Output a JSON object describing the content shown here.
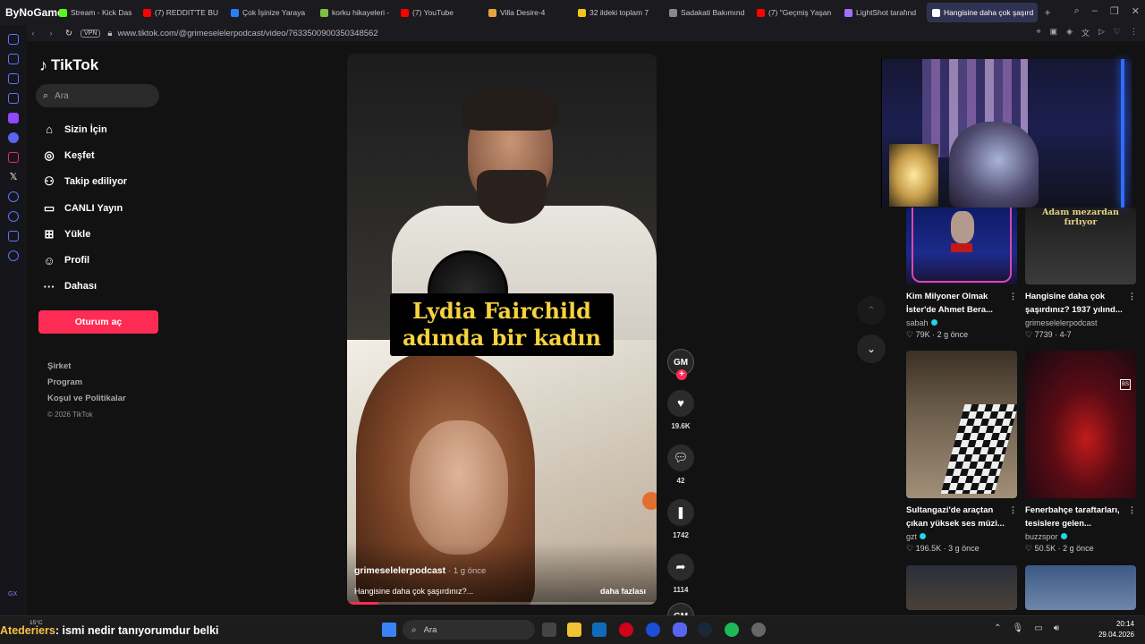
{
  "browser": {
    "brand": "ByNoGame",
    "tabs": [
      {
        "label": "Stream - Kick Das",
        "color": "#53fc18"
      },
      {
        "label": "(7) REDDIT'TE BU",
        "color": "#ff0000"
      },
      {
        "label": "Çok İşinize Yaraya",
        "color": "#2d7cf6"
      },
      {
        "label": "korku hikayeleri -",
        "color": "#7ac143"
      },
      {
        "label": "(7) YouTube",
        "color": "#ff0000"
      },
      {
        "label": "Villa Desire-4",
        "color": "#e8a33d"
      },
      {
        "label": "32 ildeki toplam 7",
        "color": "#f0c419"
      },
      {
        "label": "Sadakati Bakımınd",
        "color": "#888888"
      },
      {
        "label": "(7) \"Geçmiş Yaşan",
        "color": "#ff0000"
      },
      {
        "label": "LightShot tarafınd",
        "color": "#a070ff"
      },
      {
        "label": "Hangisine daha çok şaşırd",
        "color": "#ffffff"
      }
    ],
    "new_tab": "+",
    "vpn": "VPN",
    "url": "www.tiktok.com/@grimeselelerpodcast/video/7633500900350348562"
  },
  "tiktok": {
    "logo": "TikTok",
    "search_placeholder": "Ara",
    "menu": [
      {
        "label": "Sizin İçin",
        "icon": "home-icon",
        "glyph": "⌂"
      },
      {
        "label": "Keşfet",
        "icon": "compass-icon",
        "glyph": "◎"
      },
      {
        "label": "Takip ediliyor",
        "icon": "following-icon",
        "glyph": "⚇"
      },
      {
        "label": "CANLI Yayın",
        "icon": "live-icon",
        "glyph": "▭"
      },
      {
        "label": "Yükle",
        "icon": "upload-icon",
        "glyph": "⊞"
      },
      {
        "label": "Profil",
        "icon": "profile-icon",
        "glyph": "☺"
      },
      {
        "label": "Dahası",
        "icon": "more-icon",
        "glyph": "···"
      }
    ],
    "login": "Oturum aç",
    "footer": [
      "Şirket",
      "Program",
      "Koşul ve Politikalar"
    ],
    "copyright": "© 2026 TikTok"
  },
  "video": {
    "caption_line1": "Lydia Fairchild",
    "caption_line2": "adında bir kadın",
    "author": "grimeselelerpodcast",
    "ago": "· 1 g önce",
    "description": "Hangisine daha çok şaşırdınız?...",
    "more": "daha fazlası",
    "progress": 0.1,
    "avatar": "GM",
    "likes": "19.6K",
    "comments": "42",
    "saves": "1742",
    "shares": "1114"
  },
  "recommended": [
    {
      "title": "Kim Milyoner Olmak İster'de Ahmet Bera...",
      "author": "sabah",
      "verified": true,
      "likes": "79K",
      "ago": "2 g önce"
    },
    {
      "title": "Hangisine daha çok şaşırdınız? 1937 yılınd...",
      "author": "grimeselelerpodcast",
      "verified": false,
      "likes": "7739",
      "ago": "4-7",
      "thumb_text": "Adam mezardan fırlıyor"
    },
    {
      "title": "Sultangazi'de araçtan çıkan yüksek ses müzi...",
      "author": "gzt",
      "verified": true,
      "likes": "196.5K",
      "ago": "3 g önce"
    },
    {
      "title": "Fenerbahçe taraftarları, tesislere gelen...",
      "author": "buzzspor",
      "verified": true,
      "likes": "50.5K",
      "ago": "2 g önce",
      "thumb_badge": "BS"
    }
  ],
  "taskbar": {
    "ticker_name": "Atederiers",
    "ticker_text": ": ismi nedir tanıyorumdur belki",
    "weather": "15°C",
    "search": "Ara",
    "time": "20:14",
    "date": "29.04.2026"
  }
}
